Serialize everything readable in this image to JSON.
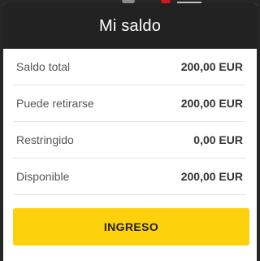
{
  "modal": {
    "title": "Mi saldo"
  },
  "balance_rows": [
    {
      "label": "Saldo total",
      "value": "200,00 EUR"
    },
    {
      "label": "Puede retirarse",
      "value": "200,00 EUR"
    },
    {
      "label": "Restringido",
      "value": "0,00 EUR"
    },
    {
      "label": "Disponible",
      "value": "200,00 EUR"
    }
  ],
  "actions": {
    "deposit_label": "INGRESO"
  },
  "colors": {
    "header_bg": "#222222",
    "accent": "#fdd10b",
    "divider": "#e6e6e6"
  }
}
